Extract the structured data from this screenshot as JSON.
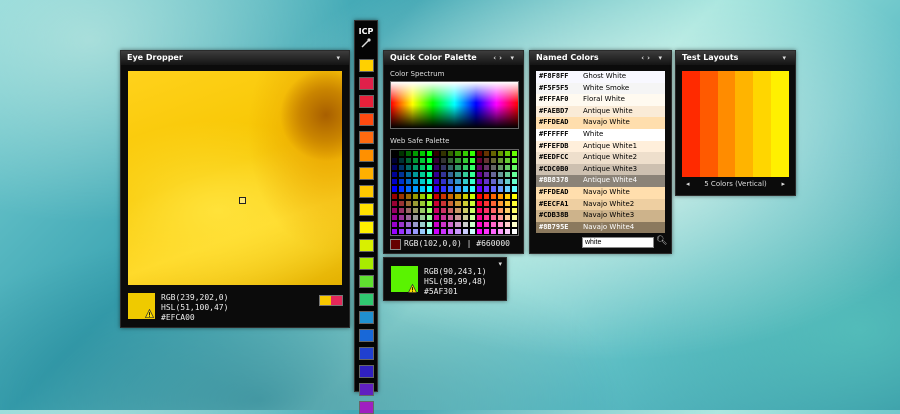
{
  "eye_dropper": {
    "title": "Eye Dropper",
    "menu_icon": "chevron-down-icon",
    "sample_color": "#EFCA00",
    "rgb": "RGB(239,202,0)",
    "hsl": "HSL(51,100,47)",
    "hex": "#EFCA00",
    "pair_colors": [
      "#f7c800",
      "#e4285a"
    ]
  },
  "toolbar": {
    "logo": "ICP",
    "picker_icon": "eyedropper-icon",
    "swatches": [
      "#ffd000",
      "#e0204a",
      "#e8203a",
      "#ff4a10",
      "#ff6a10",
      "#ff9000",
      "#ffb000",
      "#ffc800",
      "#ffe000",
      "#fff000",
      "#d8f000",
      "#a8ec00",
      "#60e030",
      "#30c870",
      "#2090d0",
      "#1868d8",
      "#2040d0",
      "#3020c0",
      "#6020c0",
      "#a020c0"
    ]
  },
  "quick_palette": {
    "title": "Quick Color Palette",
    "controls": "‹› ▾",
    "spectrum_label": "Color Spectrum",
    "websafe_label": "Web Safe Palette",
    "current_color": "#660000",
    "current_text": "RGB(102,0,0) | #660000"
  },
  "selected": {
    "color": "#5AF301",
    "rgb": "RGB(90,243,1)",
    "hsl": "HSL(98,99,48)",
    "hex": "#5AF301"
  },
  "named_colors": {
    "title": "Named Colors",
    "controls": "‹› ▾",
    "items": [
      {
        "hex": "#F8F8FF",
        "name": "Ghost White"
      },
      {
        "hex": "#F5F5F5",
        "name": "White Smoke"
      },
      {
        "hex": "#FFFAF0",
        "name": "Floral White"
      },
      {
        "hex": "#FAEBD7",
        "name": "Antique White"
      },
      {
        "hex": "#FFDEAD",
        "name": "Navajo White"
      },
      {
        "hex": "#FFFFFF",
        "name": "White"
      },
      {
        "hex": "#FFEFDB",
        "name": "Antique White1"
      },
      {
        "hex": "#EEDFCC",
        "name": "Antique White2"
      },
      {
        "hex": "#CDC0B0",
        "name": "Antique White3"
      },
      {
        "hex": "#8B8378",
        "name": "Antique White4"
      },
      {
        "hex": "#FFDEAD",
        "name": "Navajo White"
      },
      {
        "hex": "#EECFA1",
        "name": "Navajo White2"
      },
      {
        "hex": "#CDB38B",
        "name": "Navajo White3"
      },
      {
        "hex": "#8B795E",
        "name": "Navajo White4"
      }
    ],
    "search_value": "white",
    "search_icon": "search-icon"
  },
  "test_layouts": {
    "title": "Test Layouts",
    "colors": [
      "#ff2a00",
      "#ff5a00",
      "#ff8c00",
      "#ffb400",
      "#ffd600",
      "#fff000"
    ],
    "nav_label": "5 Colors (Vertical)",
    "prev": "◂",
    "next": "▸"
  }
}
